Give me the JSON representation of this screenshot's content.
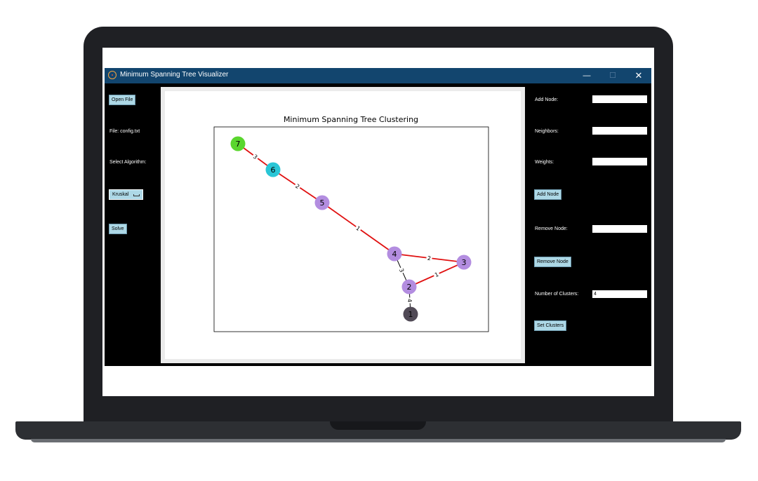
{
  "window": {
    "title": "Minimum Spanning Tree Visualizer",
    "min_glyph": "—",
    "max_glyph": "☐",
    "close_glyph": "✕"
  },
  "left_panel": {
    "open_file_label": "Open File",
    "file_label": "File: config.txt",
    "select_algorithm_label": "Select Algorithm:",
    "algorithm_selected": "Kruskal",
    "solve_label": "Solve"
  },
  "right_panel": {
    "add_node_label": "Add Node:",
    "add_node_value": "",
    "neighbors_label": "Neighbors:",
    "neighbors_value": "",
    "weights_label": "Weights:",
    "weights_value": "",
    "add_node_button": "Add Node",
    "remove_node_label": "Remove Node:",
    "remove_node_value": "",
    "remove_node_button": "Remove Node",
    "clusters_label": "Number of Clusters:",
    "clusters_value": "4",
    "set_clusters_button": "Set Clusters"
  },
  "chart_data": {
    "type": "graph",
    "title": "Minimum Spanning Tree Clustering",
    "nodes": [
      {
        "id": "1",
        "color": "#514a56"
      },
      {
        "id": "2",
        "color": "#b38de0"
      },
      {
        "id": "3",
        "color": "#b38de0"
      },
      {
        "id": "4",
        "color": "#b38de0"
      },
      {
        "id": "5",
        "color": "#b38de0"
      },
      {
        "id": "6",
        "color": "#29c6d6"
      },
      {
        "id": "7",
        "color": "#5ad62e"
      }
    ],
    "edges": [
      {
        "from": "7",
        "to": "6",
        "weight": "3",
        "in_mst": true
      },
      {
        "from": "6",
        "to": "5",
        "weight": "2",
        "in_mst": true
      },
      {
        "from": "5",
        "to": "4",
        "weight": "1",
        "in_mst": true
      },
      {
        "from": "4",
        "to": "3",
        "weight": "2",
        "in_mst": true
      },
      {
        "from": "3",
        "to": "2",
        "weight": "1",
        "in_mst": true
      },
      {
        "from": "4",
        "to": "2",
        "weight": "3",
        "in_mst": false
      },
      {
        "from": "2",
        "to": "1",
        "weight": "4",
        "in_mst": false
      }
    ],
    "mst_edge_color": "#e01010",
    "other_edge_color": "#000000"
  }
}
